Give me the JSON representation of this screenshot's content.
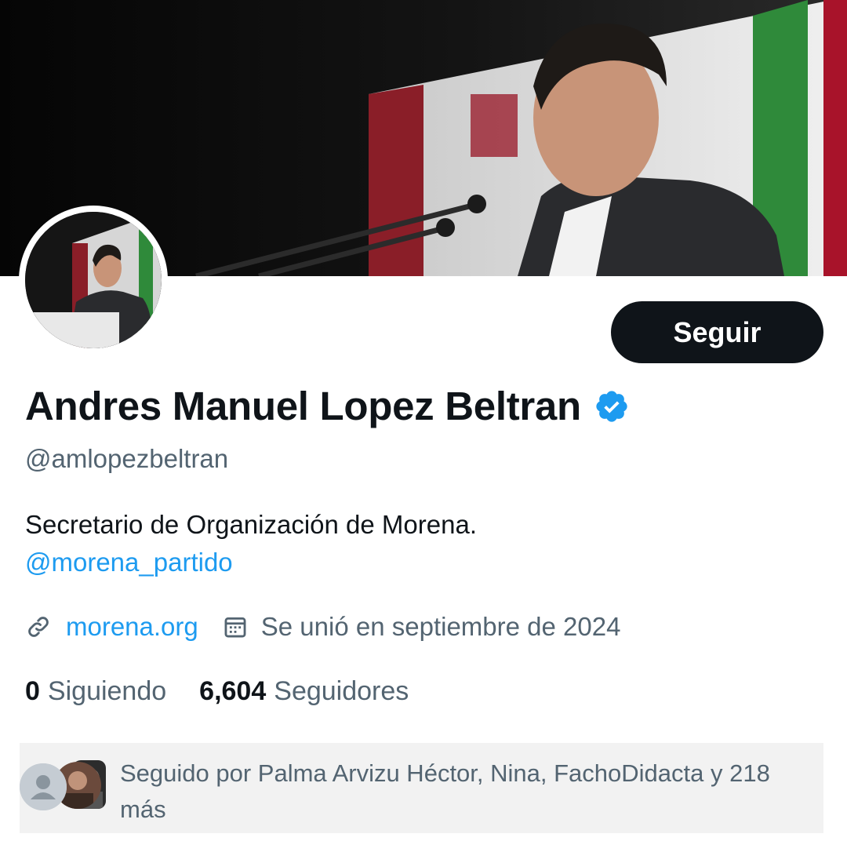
{
  "profile": {
    "display_name": "Andres Manuel Lopez Beltran",
    "handle": "@amlopezbeltran",
    "bio_text": "Secretario de Organización de Morena.",
    "bio_mention": "@morena_partido",
    "website": "morena.org",
    "joined": "Se unió en septiembre de 2024",
    "verified_icon": "verified-badge-icon"
  },
  "actions": {
    "follow_label": "Seguir"
  },
  "stats": {
    "following_count": "0",
    "following_label": "Siguiendo",
    "followers_count": "6,604",
    "followers_label": "Seguidores"
  },
  "followed_by": {
    "text": "Seguido por Palma Arvizu Héctor, Nina, FachoDidacta y 218 más"
  },
  "colors": {
    "accent": "#1d9bf0",
    "text_primary": "#0f1419",
    "text_secondary": "#536471",
    "button_bg": "#0f1419"
  }
}
